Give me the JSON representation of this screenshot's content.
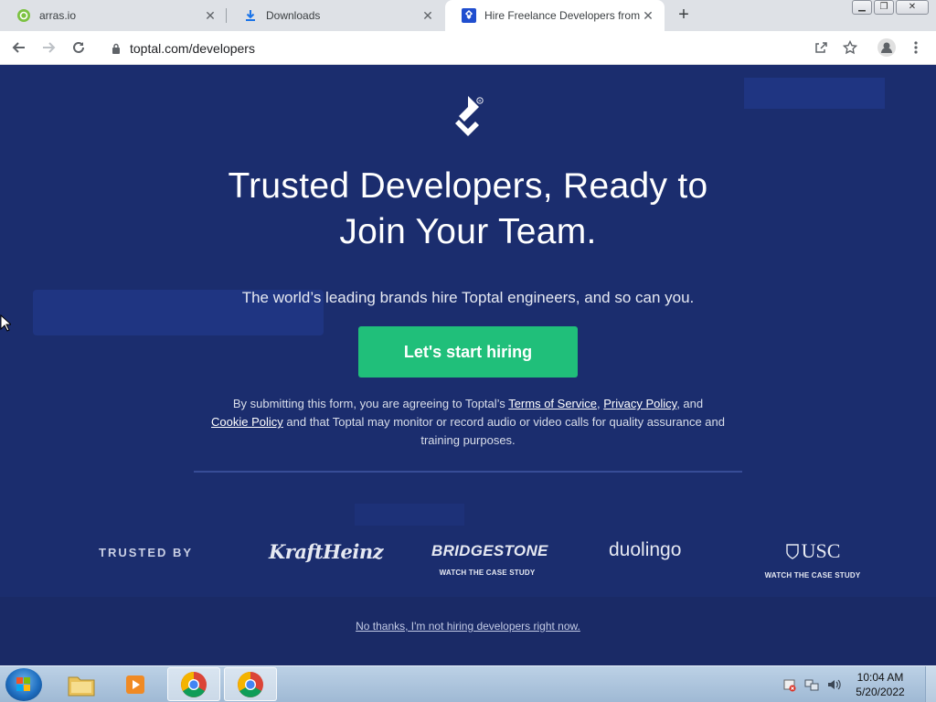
{
  "browser": {
    "tabs": [
      {
        "title": "arras.io",
        "favicon": "arras-icon",
        "active": false
      },
      {
        "title": "Downloads",
        "favicon": "download-icon",
        "active": false
      },
      {
        "title": "Hire Freelance Developers from t",
        "favicon": "toptal-icon",
        "active": true
      }
    ],
    "address": "toptal.com/developers"
  },
  "page": {
    "headline_line1": "Trusted Developers, Ready to",
    "headline_line2": "Join Your Team.",
    "subhead": "The world’s leading brands hire Toptal engineers, and so can you.",
    "cta_label": "Let's start hiring",
    "legal": {
      "part1": "By submitting this form, you are agreeing to Toptal’s ",
      "terms": "Terms of Service",
      "sep1": ", ",
      "privacy": "Privacy Policy",
      "part2": ", and",
      "cookie": "Cookie Policy",
      "part3": " and that Toptal may monitor or record audio or video calls for quality assurance and training purposes."
    },
    "trusted_by": "TRUSTED BY",
    "brands": [
      {
        "name": "KraftHeinz",
        "case_study": ""
      },
      {
        "name": "BRIDGESTONE",
        "case_study": "WATCH THE CASE STUDY"
      },
      {
        "name": "duolingo",
        "case_study": ""
      },
      {
        "name": "USC",
        "case_study": "WATCH THE CASE STUDY"
      }
    ],
    "decline_link": "No thanks, I'm not hiring developers right now."
  },
  "taskbar": {
    "time": "10:04 AM",
    "date": "5/20/2022"
  },
  "colors": {
    "page_bg": "#1b2d6e",
    "cta": "#20bf7a"
  }
}
